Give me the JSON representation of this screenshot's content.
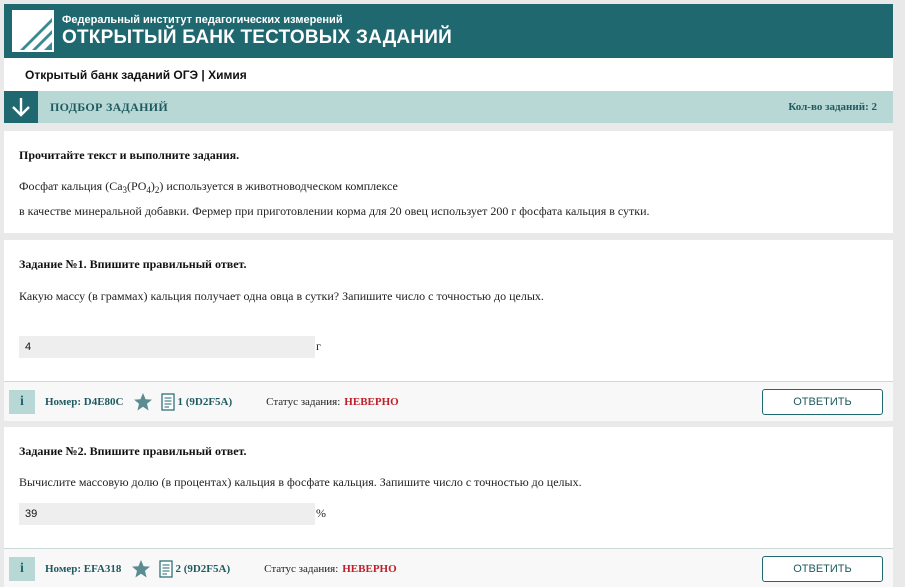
{
  "header": {
    "subtitle": "Федеральный институт педагогических измерений",
    "title": "ОТКРЫТЫЙ БАНК ТЕСТОВЫХ ЗАДАНИЙ",
    "brand_color": "#1f6870"
  },
  "breadcrumb": "Открытый банк заданий ОГЭ | Химия",
  "filter": {
    "title": "ПОДБОР ЗАДАНИЙ",
    "count_label": "Кол-во заданий: 2"
  },
  "intro": {
    "heading": "Прочитайте текст и выполните задания.",
    "line1_pre": "Фосфат кальция (Ca",
    "sub1": "3",
    "mid1": "(PO",
    "sub2": "4",
    "mid2": ")",
    "sub3": "2",
    "line1_post": ") используется в животноводческом комплексе",
    "line2": "в качестве минеральной добавки. Фермер при приготовлении корма для 20 овец использует 200 г фосфата кальция в сутки."
  },
  "tasks": [
    {
      "heading": "Задание №1. Впишите правильный ответ.",
      "question": "Какую массу (в граммах) кальция получает одна овца в сутки? Запишите число с точностью до целых.",
      "answer": "4",
      "unit": "г",
      "number": "Номер: D4E80C",
      "doc_code": "1 (9D2F5A)",
      "status_label": "Статус задания:",
      "status": "НЕВЕРНО",
      "button": "ОТВЕТИТЬ"
    },
    {
      "heading": "Задание №2. Впишите правильный ответ.",
      "question": "Вычислите массовую долю (в процентах) кальция в фосфате кальция. Запишите число с точностью до целых.",
      "answer": "39",
      "unit": "%",
      "number": "Номер: EFA318",
      "doc_code": "2 (9D2F5A)",
      "status_label": "Статус задания:",
      "status": "НЕВЕРНО",
      "button": "ОТВЕТИТЬ"
    }
  ],
  "info_glyph": "i",
  "icons": {
    "logo": "fipi-logo-icon",
    "filter": "arrow-down-icon",
    "favorite": "star-icon",
    "doc": "document-icon"
  },
  "colors": {
    "accent_light": "#b8d8d5",
    "status_wrong": "#c0202a"
  }
}
